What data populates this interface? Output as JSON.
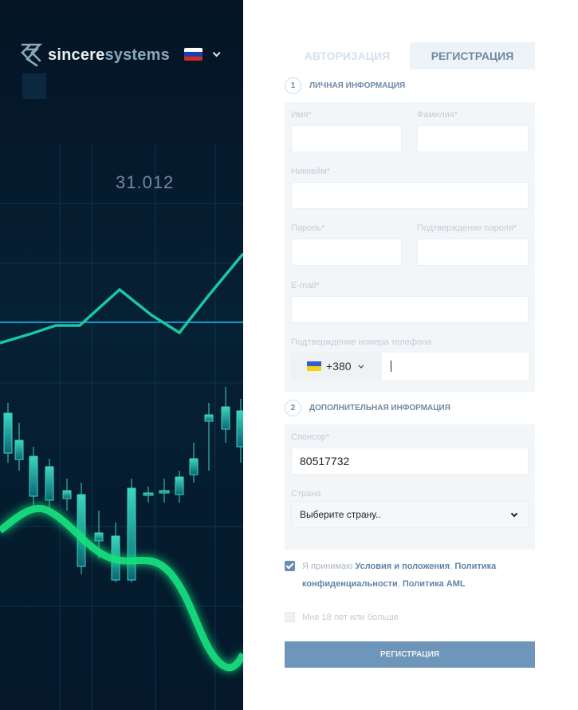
{
  "brand": {
    "name_part1": "sincere",
    "name_part2": "systems"
  },
  "chart_overlay_value": "31.012",
  "tabs": [
    {
      "label": "АВТОРИЗАЦИЯ",
      "active": false
    },
    {
      "label": "РЕГИСТРАЦИЯ",
      "active": true
    }
  ],
  "section1": {
    "number": "1",
    "title": "ЛИЧНАЯ ИНФОРМАЦИЯ",
    "first_name_label": "Имя*",
    "last_name_label": "Фамилия*",
    "nickname_label": "Никнейм*",
    "password_label": "Пароль*",
    "password_confirm_label": "Подтверждение пароля*",
    "email_label": "E-mail*",
    "phone_label": "Подтверждение номера телефона",
    "phone_code": "+380"
  },
  "section2": {
    "number": "2",
    "title": "ДОПОЛНИТЕЛЬНАЯ ИНФОРМАЦИЯ",
    "sponsor_label": "Спонсор*",
    "sponsor_value": "80517732",
    "country_label": "Страна",
    "country_selected": "Выберите страну.."
  },
  "agreements": {
    "terms_prefix": "Я принимаю",
    "terms_link": "Условия и положения",
    "sep1": ",",
    "privacy_link_line1": "Политика",
    "privacy_link_line2": "конфиденциальности",
    "sep2": ",",
    "aml_link": "Политика AML",
    "age_label": "Мне 18 лет или больше",
    "terms_checked": true,
    "age_checked": false
  },
  "submit_label": "РЕГИСТРАЦИЯ",
  "colors": {
    "accent": "#6e95ba",
    "link": "#5f84a8",
    "chart_green": "#14d99a",
    "chart_cyan": "#1ec8d8"
  }
}
